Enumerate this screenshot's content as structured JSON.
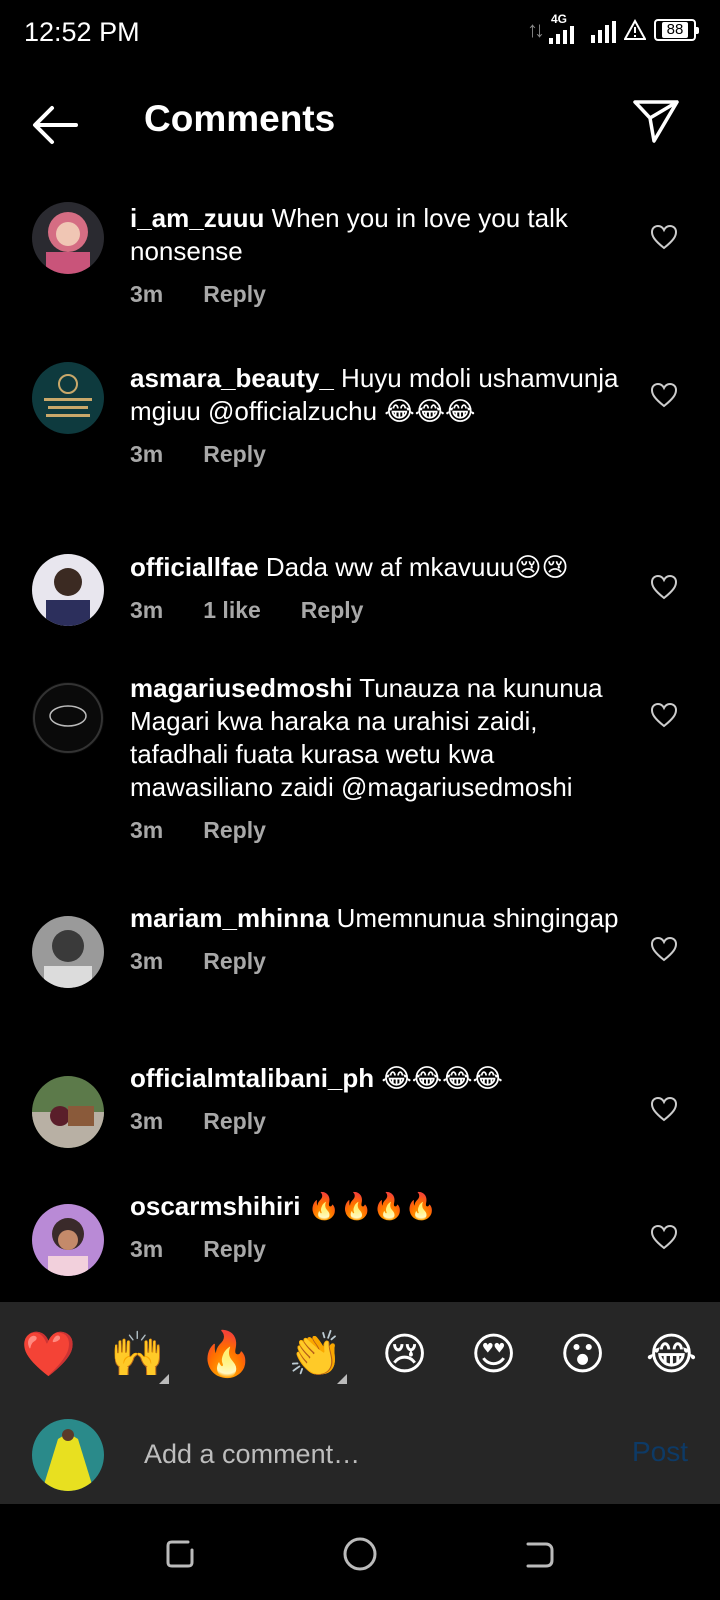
{
  "status": {
    "time": "12:52 PM",
    "network": "4G",
    "battery": "88",
    "data_arrows": "↑↓"
  },
  "header": {
    "title": "Comments",
    "back_icon": "arrow-left-icon",
    "send_icon": "paper-plane-icon"
  },
  "comments": [
    {
      "username": "i_am_zuuu",
      "text": "When you in love you talk nonsense",
      "time": "3m",
      "likes": "",
      "reply": "Reply",
      "avatar_color": "#b03a52"
    },
    {
      "username": "asmara_beauty_",
      "text": "Huyu mdoli ushamvunja mgiuu @officialzuchu 😂😂😂",
      "time": "3m",
      "likes": "",
      "reply": "Reply",
      "avatar_color": "#0e3a3e"
    },
    {
      "username": "officiallfae",
      "text": "Dada ww af mkavuuu😢😢",
      "time": "3m",
      "likes": "1 like",
      "reply": "Reply",
      "avatar_color": "#3a3550"
    },
    {
      "username": "magariusedmoshi",
      "text": "Tunauza na kununua Magari kwa haraka na urahisi zaidi, tafadhali fuata kurasa wetu kwa mawasiliano zaidi @magariusedmoshi",
      "time": "3m",
      "likes": "",
      "reply": "Reply",
      "avatar_color": "#0a0a0a"
    },
    {
      "username": "mariam_mhinna",
      "text": "Umemnunua shingingap",
      "time": "3m",
      "likes": "",
      "reply": "Reply",
      "avatar_color": "#7a7a7a"
    },
    {
      "username": "officialmtalibani_ph",
      "text": "😂😂😂😂",
      "time": "3m",
      "likes": "",
      "reply": "Reply",
      "avatar_color": "#6b4a3a"
    },
    {
      "username": "oscarmshihiri",
      "text": "🔥🔥🔥🔥",
      "time": "3m",
      "likes": "",
      "reply": "Reply",
      "avatar_color": "#a56a9a"
    }
  ],
  "emoji_bar": [
    "❤️",
    "🙌",
    "🔥",
    "👏",
    "😢",
    "😍",
    "😮",
    "😂"
  ],
  "input": {
    "placeholder": "Add a comment…",
    "post_label": "Post"
  },
  "colors": {
    "background": "#000000",
    "panel": "#262626",
    "meta_text": "#a8a8a8",
    "post_disabled": "#0d3a66"
  }
}
